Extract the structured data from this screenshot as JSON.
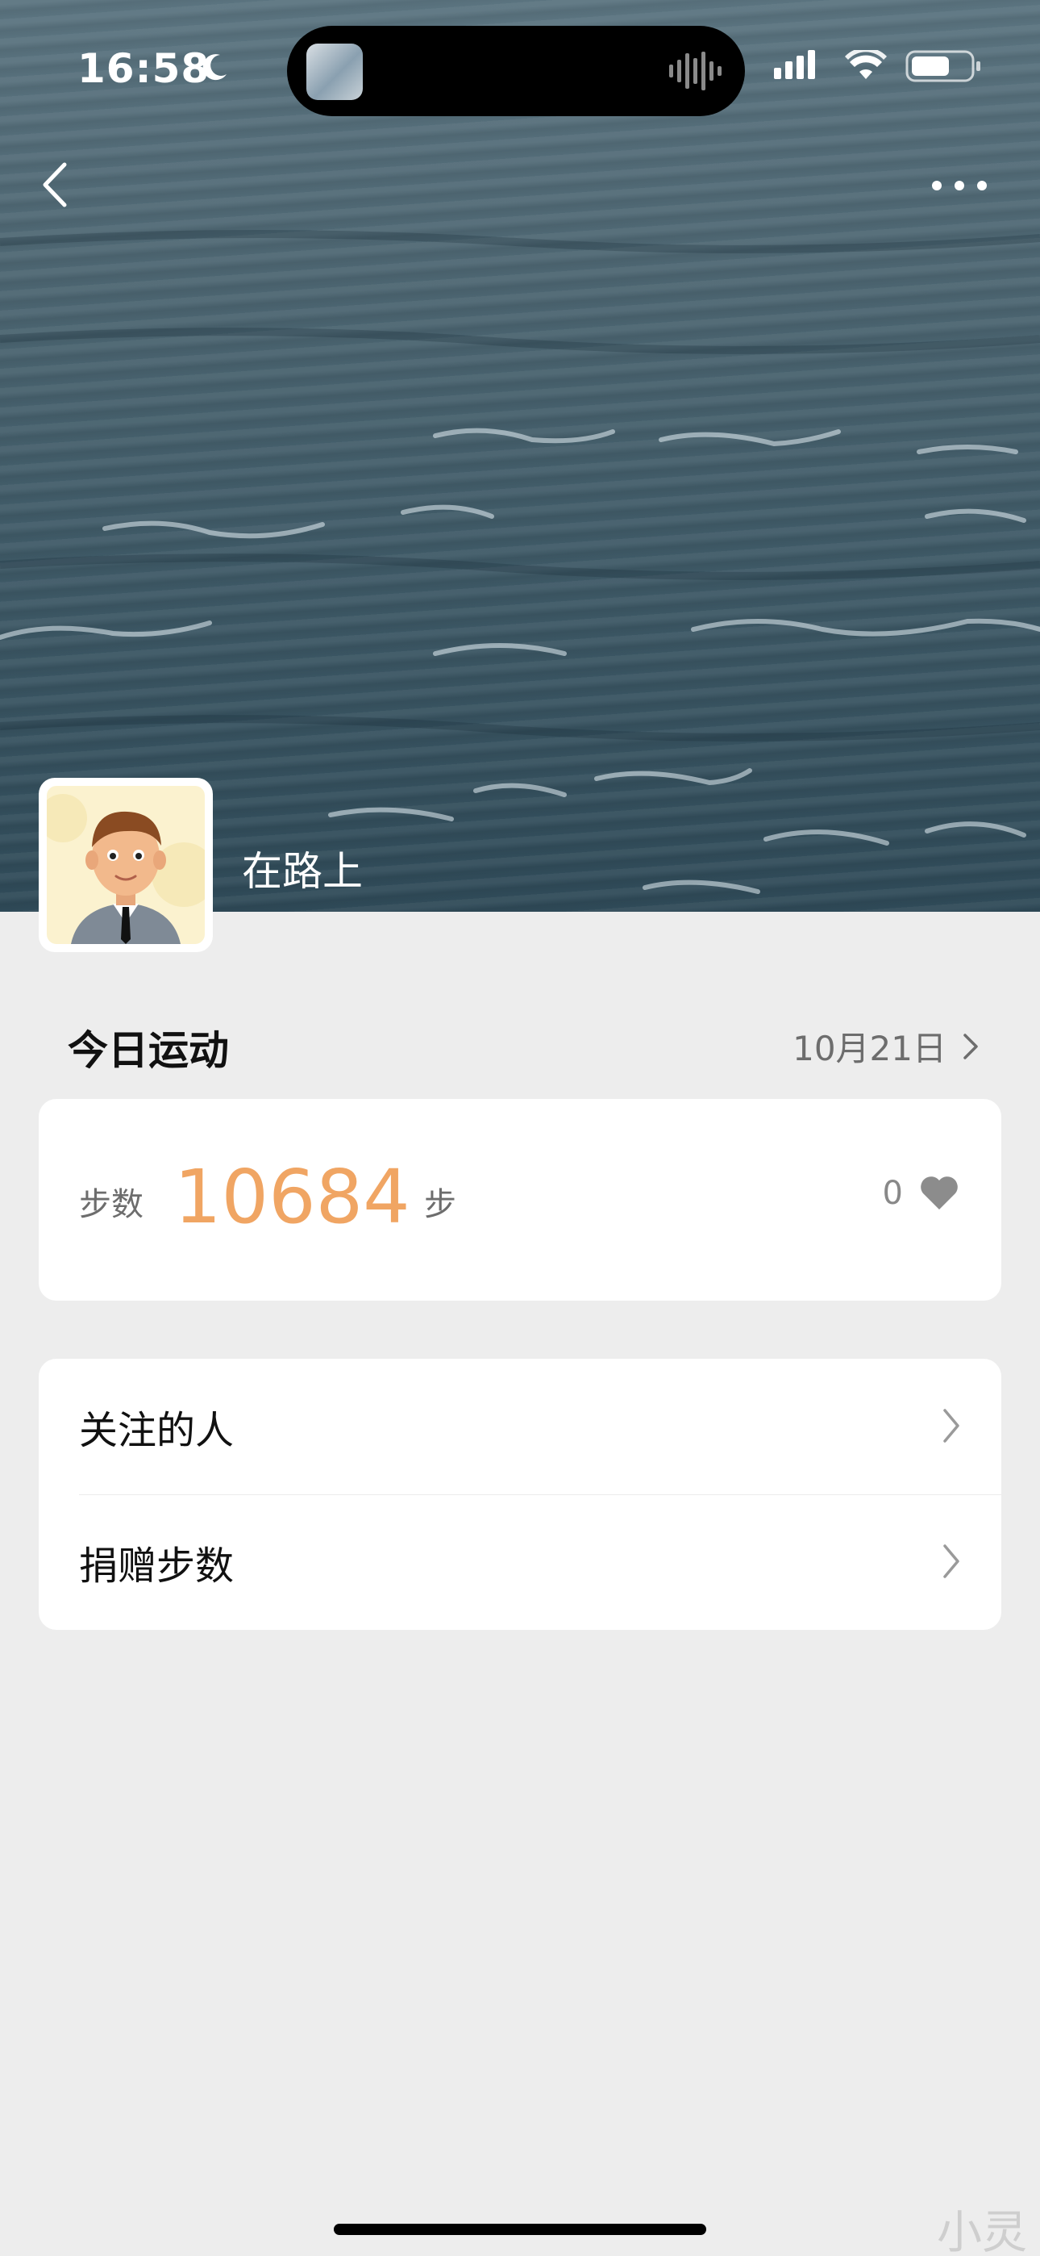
{
  "status_bar": {
    "time": "16:58"
  },
  "profile": {
    "username": "在路上"
  },
  "today": {
    "title": "今日运动",
    "date": "10月21日"
  },
  "steps": {
    "label": "步数",
    "value": "10684",
    "unit": "步",
    "likes": "0"
  },
  "menu": [
    {
      "label": "关注的人"
    },
    {
      "label": "捐赠步数"
    }
  ],
  "watermark": "小灵",
  "colors": {
    "background": "#ededed",
    "accent_orange": "#f0a563",
    "card": "#ffffff"
  }
}
